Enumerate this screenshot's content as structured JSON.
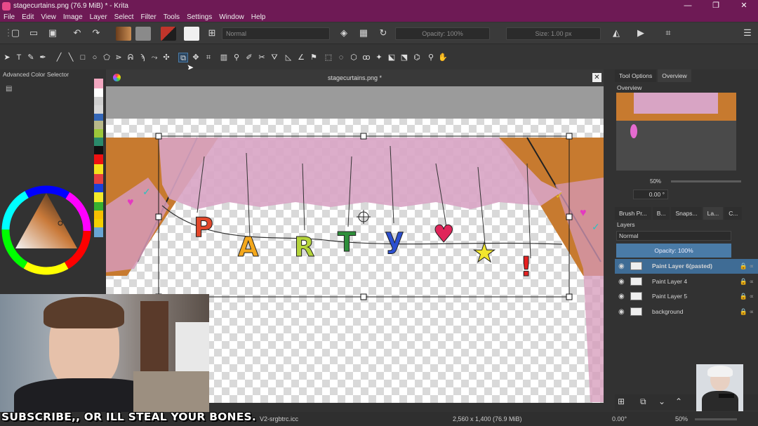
{
  "window": {
    "title": "stagecurtains.png (76.9 MiB)  * - Krita",
    "controls": [
      "—",
      "❐",
      "✕"
    ]
  },
  "menu": [
    "File",
    "Edit",
    "View",
    "Image",
    "Layer",
    "Select",
    "Filter",
    "Tools",
    "Settings",
    "Window",
    "Help"
  ],
  "toolbar": {
    "blend_mode": "Normal",
    "opacity": "Opacity: 100%",
    "size": "Size: 1.00 px"
  },
  "left_dock": {
    "title": "Advanced Color Selector"
  },
  "document": {
    "tab_title": "stagecurtains.png *",
    "banner_letters": [
      "P",
      "A",
      "R",
      "T",
      "y",
      "♥",
      "★",
      "!"
    ]
  },
  "right_dock": {
    "tabs": [
      "Tool Options",
      "Overview"
    ],
    "overview_title": "Overview",
    "zoom": "50%",
    "rotation": "0.00 °",
    "bottom_tabs": [
      "Brush Pr...",
      "B...",
      "Snaps...",
      "La...",
      "C..."
    ],
    "layers_title": "Layers",
    "layer_blend": "Normal",
    "layer_opacity": "Opacity:  100%",
    "layers": [
      {
        "name": "Paint Layer 6(pasted)",
        "selected": true
      },
      {
        "name": "Paint Layer 4",
        "selected": false
      },
      {
        "name": "Paint Layer 5",
        "selected": false
      },
      {
        "name": "background",
        "selected": false
      }
    ]
  },
  "status": {
    "profile": "V2-srgbtrc.icc",
    "dimensions": "2,560 x 1,400 (76.9 MiB)",
    "rotation": "0.00°",
    "zoom": "50%"
  },
  "overlay": {
    "caption": "SUBSCRIBE,, OR ILL STEAL YOUR BONES."
  },
  "colors": {
    "titlebar": "#6e1a55",
    "accent": "#4a7ba7",
    "curtain": "#c77a2f",
    "drape": "#d8a4c4"
  }
}
